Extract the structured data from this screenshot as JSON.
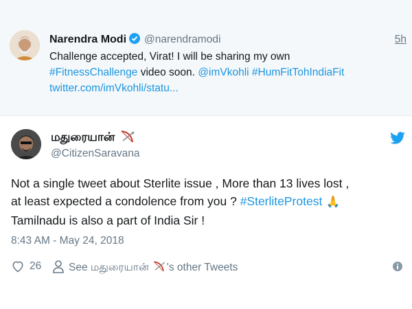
{
  "quoted_tweet": {
    "author_name": "Narendra Modi",
    "handle": "@narendramodi",
    "time": "5h",
    "text_parts": {
      "t1": "Challenge accepted, Virat! I will be sharing my own",
      "hashtag1": "#FitnessChallenge",
      "t2": " video soon. ",
      "mention": "@imVkohli",
      "t3": " ",
      "hashtag2": "#HumFitTohIndiaFit",
      "link": "twitter.com/imVkohli/statu..."
    },
    "icons": {
      "avatar": "profile-photo",
      "verified": "verified-badge-icon"
    }
  },
  "tweet": {
    "author_name": "மதுரையான்",
    "handle": "@CitizenSaravana",
    "text_parts": {
      "line1": "Not a single tweet about Sterlite issue , More than 13 lives lost ,",
      "line2a": "at least expected a condolence from you ? ",
      "hashtag": "#SterliteProtest",
      "line3": "Tamilnadu is also  a part of India Sir !"
    },
    "timestamp": "8:43 AM - May 24, 2018",
    "like_count": "26",
    "see_other_prefix": "See மதுரையான்",
    "see_other_suffix": "'s other Tweets",
    "icons": {
      "bow": "bow-and-arrow-icon",
      "twitter": "twitter-bird-icon",
      "pray": "folded-hands-emoji",
      "like": "heart-icon",
      "profile": "person-icon",
      "info": "info-icon"
    },
    "colors": {
      "link": "#1b95e0",
      "twitter_blue": "#1da1f2",
      "secondary_text": "#657786"
    }
  }
}
